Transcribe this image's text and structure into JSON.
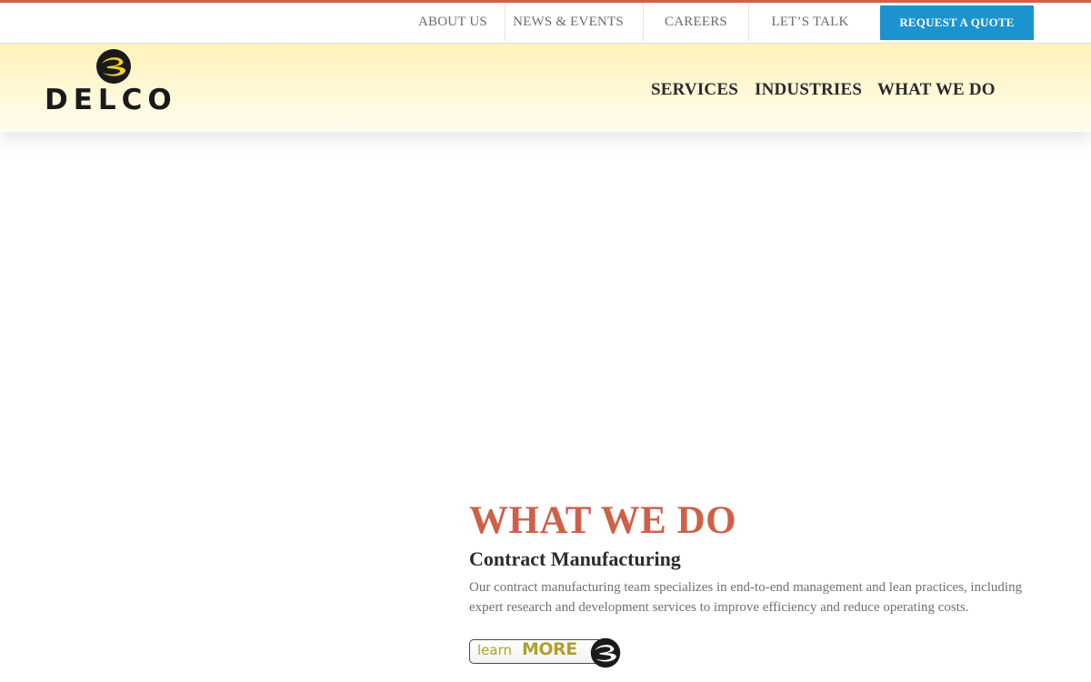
{
  "utility_nav": {
    "links": [
      "ABOUT US",
      "NEWS & EVENTS",
      "CAREERS",
      "LET’S TALK"
    ],
    "cta": "REQUEST A QUOTE"
  },
  "brand": {
    "logo_text": "DELCO",
    "logo_icon": "delco-swoosh-icon"
  },
  "main_nav": {
    "items": [
      "SERVICES",
      "INDUSTRIES",
      "WHAT WE DO"
    ]
  },
  "section": {
    "heading": "WHAT WE DO",
    "subtitle": "Contract Manufacturing",
    "body": "Our contract manufacturing team specializes in end-to-end management and lean practices, including expert research and development services to improve efficiency and reduce operating costs.",
    "cta_learn": "learn",
    "cta_more": "MORE"
  },
  "colors": {
    "accent_top": "#d35f45",
    "cta_blue": "#1b93cf",
    "heading_red": "#cf6048",
    "header_gradient_top": "#fff3b8",
    "logo_yellow": "#f1d22a",
    "learn_more_olive": "#b1a02c"
  }
}
